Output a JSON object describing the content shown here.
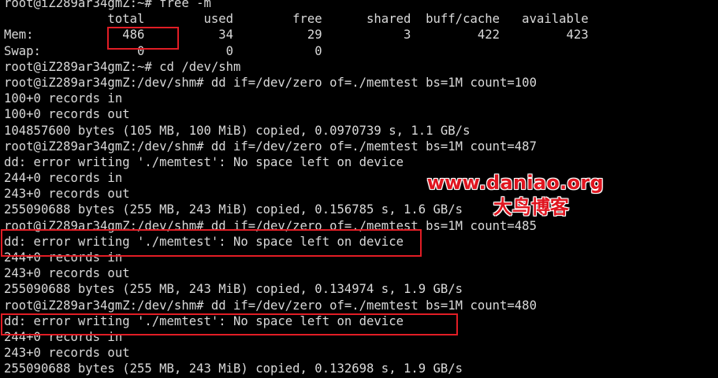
{
  "terminal": {
    "lines": [
      "root@iZ289ar34gmZ:~# free -m",
      "              total        used        free      shared  buff/cache   available",
      "Mem:            486          34          29           3         422         423",
      "Swap:             0           0           0",
      "root@iZ289ar34gmZ:~# cd /dev/shm",
      "root@iZ289ar34gmZ:/dev/shm# dd if=/dev/zero of=./memtest bs=1M count=100",
      "100+0 records in",
      "100+0 records out",
      "104857600 bytes (105 MB, 100 MiB) copied, 0.0970739 s, 1.1 GB/s",
      "root@iZ289ar34gmZ:/dev/shm# dd if=/dev/zero of=./memtest bs=1M count=487",
      "dd: error writing './memtest': No space left on device",
      "244+0 records in",
      "243+0 records out",
      "255090688 bytes (255 MB, 243 MiB) copied, 0.156785 s, 1.6 GB/s",
      "root@iZ289ar34gmZ:/dev/shm# dd if=/dev/zero of=./memtest bs=1M count=485",
      "dd: error writing './memtest': No space left on device",
      "244+0 records in",
      "243+0 records out",
      "255090688 bytes (255 MB, 243 MiB) copied, 0.134974 s, 1.9 GB/s",
      "root@iZ289ar34gmZ:/dev/shm# dd if=/dev/zero of=./memtest bs=1M count=480",
      "dd: error writing './memtest': No space left on device",
      "244+0 records in",
      "243+0 records out",
      "255090688 bytes (255 MB, 243 MiB) copied, 0.132698 s, 1.9 GB/s"
    ]
  },
  "watermark": {
    "url": "www.daniao.org",
    "name": "大鸟博客"
  },
  "colors": {
    "background": "#000000",
    "text": "#d9d9d9",
    "highlight": "#e11d25",
    "watermark": "#e0151f"
  }
}
